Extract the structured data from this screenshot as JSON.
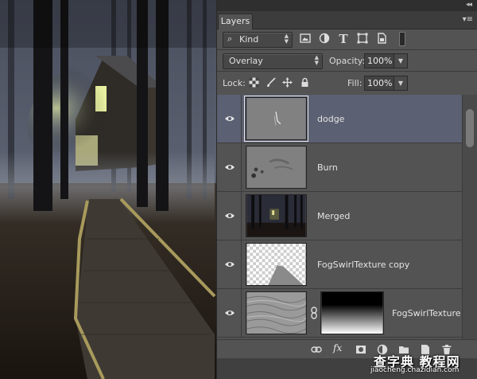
{
  "panel": {
    "collapse_glyph": "◂◂",
    "tab_label": "Layers",
    "menu_glyph": "▾≡"
  },
  "filter": {
    "kind_label": "Kind",
    "icons": [
      "image-filter-icon",
      "adjustment-filter-icon",
      "type-filter-icon",
      "shape-filter-icon",
      "smart-object-filter-icon"
    ]
  },
  "blend": {
    "mode": "Overlay",
    "opacity_label": "Opacity:",
    "opacity_value": "100%"
  },
  "lock": {
    "label": "Lock:",
    "fill_label": "Fill:",
    "fill_value": "100%"
  },
  "layers": [
    {
      "name": "dodge",
      "selected": true,
      "visible": true
    },
    {
      "name": "Burn",
      "selected": false,
      "visible": true
    },
    {
      "name": "Merged",
      "selected": false,
      "visible": true
    },
    {
      "name": "FogSwirlTexture copy",
      "selected": false,
      "visible": true
    },
    {
      "name": "FogSwirlTexture",
      "selected": false,
      "visible": true,
      "has_mask": true
    }
  ],
  "bottom_toolbar": {
    "fx_label": "fx",
    "icons": [
      "link-layers-icon",
      "fx-icon",
      "add-mask-icon",
      "adjustment-layer-icon",
      "new-group-icon",
      "new-layer-icon",
      "delete-layer-icon"
    ]
  },
  "watermark": {
    "title": "查字典 教程网",
    "url": "jiaocheng.chazidian.com"
  }
}
